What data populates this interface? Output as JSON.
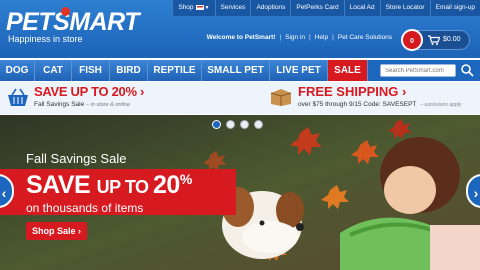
{
  "brand": {
    "name": "PETSMART",
    "tagline": "Happiness in store",
    "tm": "®"
  },
  "topnav": [
    {
      "label": "Shop"
    },
    {
      "label": "Services"
    },
    {
      "label": "Adoptions"
    },
    {
      "label": "PetPerks Card"
    },
    {
      "label": "Local Ad"
    },
    {
      "label": "Store Locator"
    },
    {
      "label": "Email sign-up"
    }
  ],
  "util": {
    "welcome": "Welcome to PetSmart!",
    "sign_in": "Sign in",
    "help": "Help",
    "pet_care": "Pet Care Solutions"
  },
  "cart": {
    "count": "0",
    "total": "$0.00"
  },
  "categories": [
    "DOG",
    "CAT",
    "FISH",
    "BIRD",
    "REPTILE",
    "SMALL PET",
    "LIVE PET",
    "SALE"
  ],
  "search": {
    "placeholder": "Search PetSmart.com"
  },
  "promo": {
    "left_main": "SAVE UP TO 20%",
    "left_chev": "›",
    "left_sub": "Fall Savings Sale",
    "left_sub_note": "– in store & online",
    "right_main": "FREE SHIPPING",
    "right_chev": "›",
    "right_sub": "over $75 through 9/15 Code: SAVESEPT",
    "right_note": "– exclusions apply"
  },
  "hero": {
    "kicker": "Fall Savings Sale",
    "headline_a": "SAVE ",
    "headline_b": "UP TO ",
    "headline_c": "20",
    "headline_pct": "%",
    "sub": "on thousands of items",
    "cta": "Shop Sale ›",
    "prev": "‹",
    "next": "›"
  },
  "carousel": {
    "slides": 4,
    "active": 1
  },
  "colors": {
    "brand_blue": "#1d66bd",
    "sale_red": "#d71920"
  }
}
